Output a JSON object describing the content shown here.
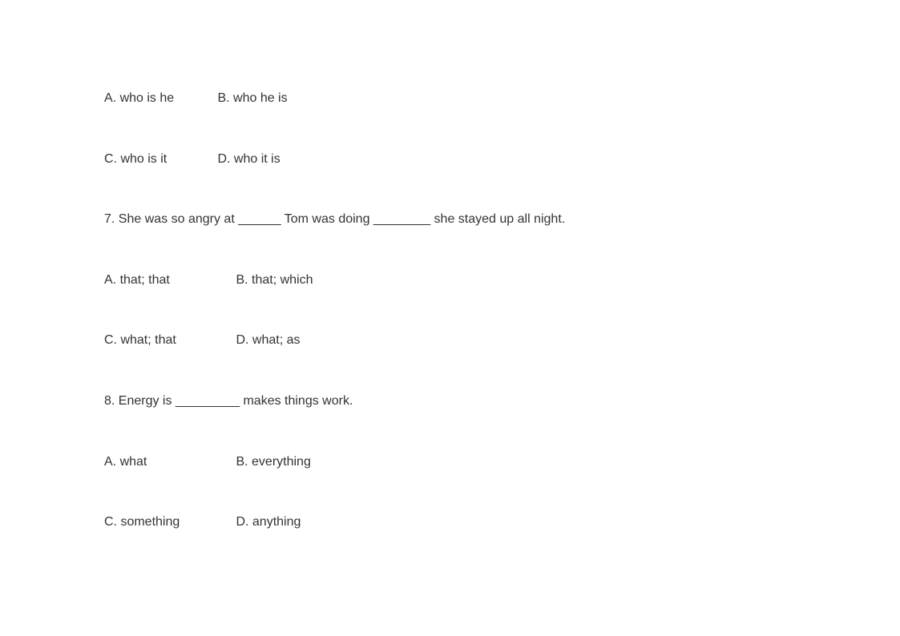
{
  "q6_options": {
    "row1": {
      "a": "A. who is he",
      "b": "B. who he is"
    },
    "row2": {
      "c": "C. who is it",
      "d": "D. who it is"
    }
  },
  "q7": {
    "text": "7. She was so angry at ______ Tom was doing ________ she stayed up all night.",
    "row1": {
      "a": "A. that; that",
      "b": "B. that; which"
    },
    "row2": {
      "c": "C. what; that",
      "d": "D. what; as"
    }
  },
  "q8": {
    "text": "8. Energy is _________ makes things work.",
    "row1": {
      "a": "A. what",
      "b": "B. everything"
    },
    "row2": {
      "c": "C. something",
      "d": "D. anything"
    }
  }
}
